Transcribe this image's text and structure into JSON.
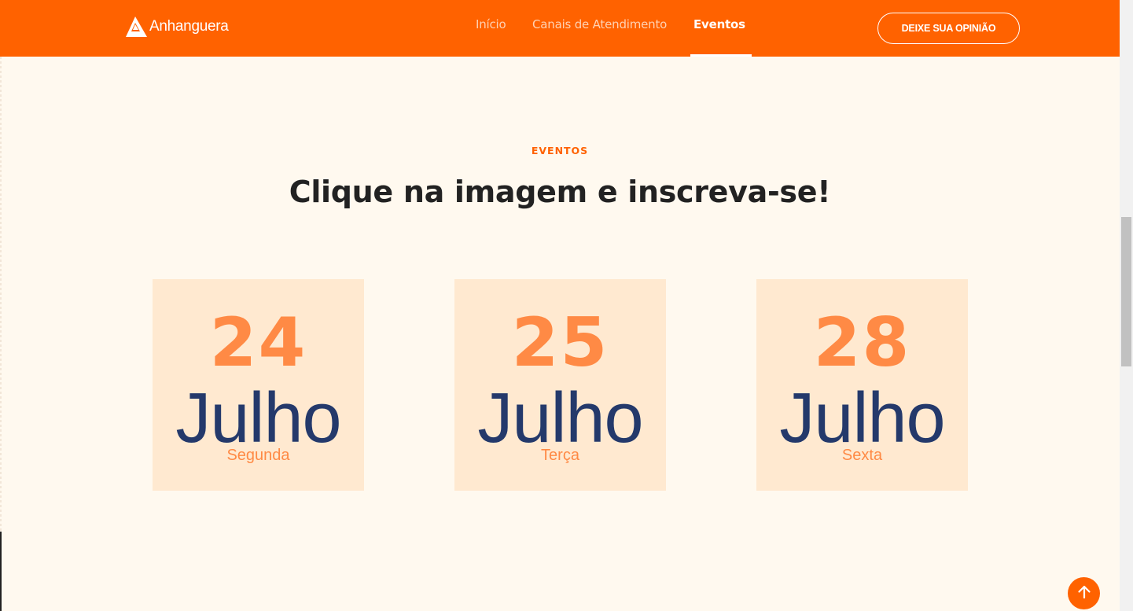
{
  "header": {
    "logo_text": "Anhanguera",
    "nav": [
      {
        "label": "Início",
        "active": false
      },
      {
        "label": "Canais de Atendimento",
        "active": false
      },
      {
        "label": "Eventos",
        "active": true
      }
    ],
    "cta_label": "DEIXE SUA OPINIÃO"
  },
  "section": {
    "eyebrow": "EVENTOS",
    "title": "Clique na imagem e inscreva-se!"
  },
  "events": [
    {
      "day": "24",
      "month": "Julho",
      "weekday": "Segunda"
    },
    {
      "day": "25",
      "month": "Julho",
      "weekday": "Terça"
    },
    {
      "day": "28",
      "month": "Julho",
      "weekday": "Sexta"
    }
  ],
  "colors": {
    "brand": "#ff6200",
    "background": "#fff9ef",
    "card": "#ffe9d0",
    "day_number": "#ff8a45",
    "month": "#24396b"
  },
  "icons": {
    "logo": "anhanguera-logo-icon",
    "scroll_top": "arrow-up-icon"
  }
}
